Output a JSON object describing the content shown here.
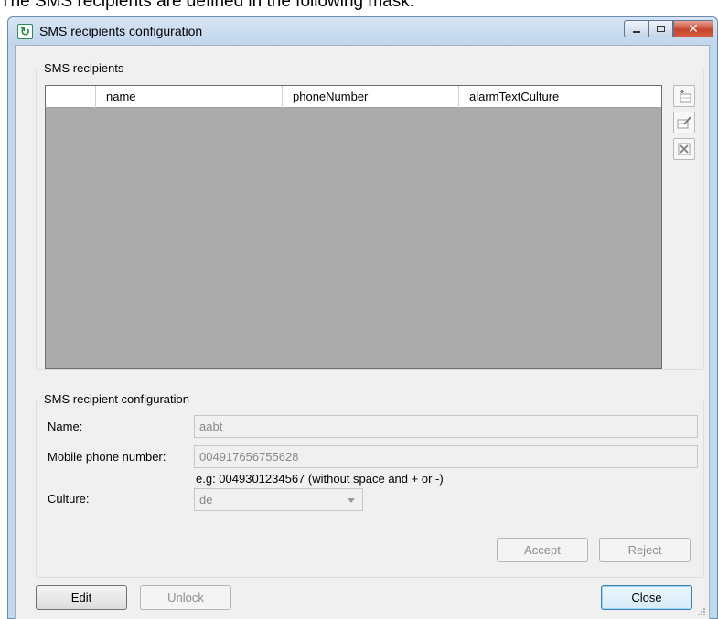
{
  "doc_text": "The SMS recipients are defined in the following mask:",
  "window": {
    "title": "SMS recipients configuration",
    "icon": "app-logo-icon",
    "controls": {
      "minimize": "minimize-icon",
      "maximize": "maximize-icon",
      "close": "close-icon"
    }
  },
  "recipients_group": {
    "legend": "SMS recipients",
    "columns": [
      "name",
      "phoneNumber",
      "alarmTextCulture"
    ],
    "rows": [],
    "side_buttons": [
      "add-row-icon",
      "edit-row-icon",
      "delete-row-icon"
    ]
  },
  "config_group": {
    "legend": "SMS recipient configuration",
    "name_label": "Name:",
    "name_value": "aabt",
    "phone_label": "Mobile phone number:",
    "phone_value": "004917656755628",
    "phone_hint": "e.g: 0049301234567 (without space and + or -)",
    "culture_label": "Culture:",
    "culture_value": "de",
    "accept_label": "Accept",
    "reject_label": "Reject"
  },
  "footer": {
    "edit_label": "Edit",
    "unlock_label": "Unlock",
    "close_label": "Close"
  }
}
